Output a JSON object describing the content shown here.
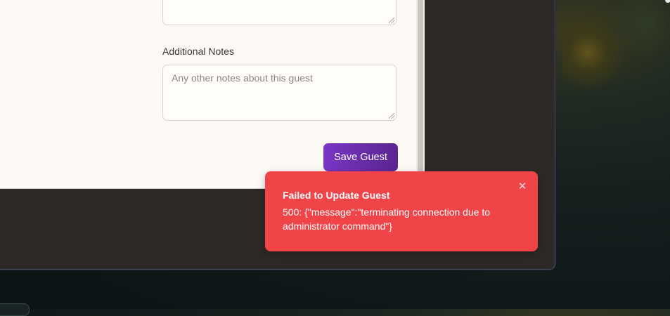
{
  "form": {
    "notes_label": "Additional Notes",
    "notes_placeholder": "Any other notes about this guest",
    "save_label": "Save Guest"
  },
  "toast": {
    "title": "Failed to Update Guest",
    "message": "500: {\"message\":\"terminating connection due to administrator command\"}",
    "close_icon": "✕"
  },
  "colors": {
    "toast_bg": "#f04448",
    "save_button_start": "#7a36c6",
    "save_button_end": "#5a2590",
    "modal_bg": "#fdfaf5"
  }
}
